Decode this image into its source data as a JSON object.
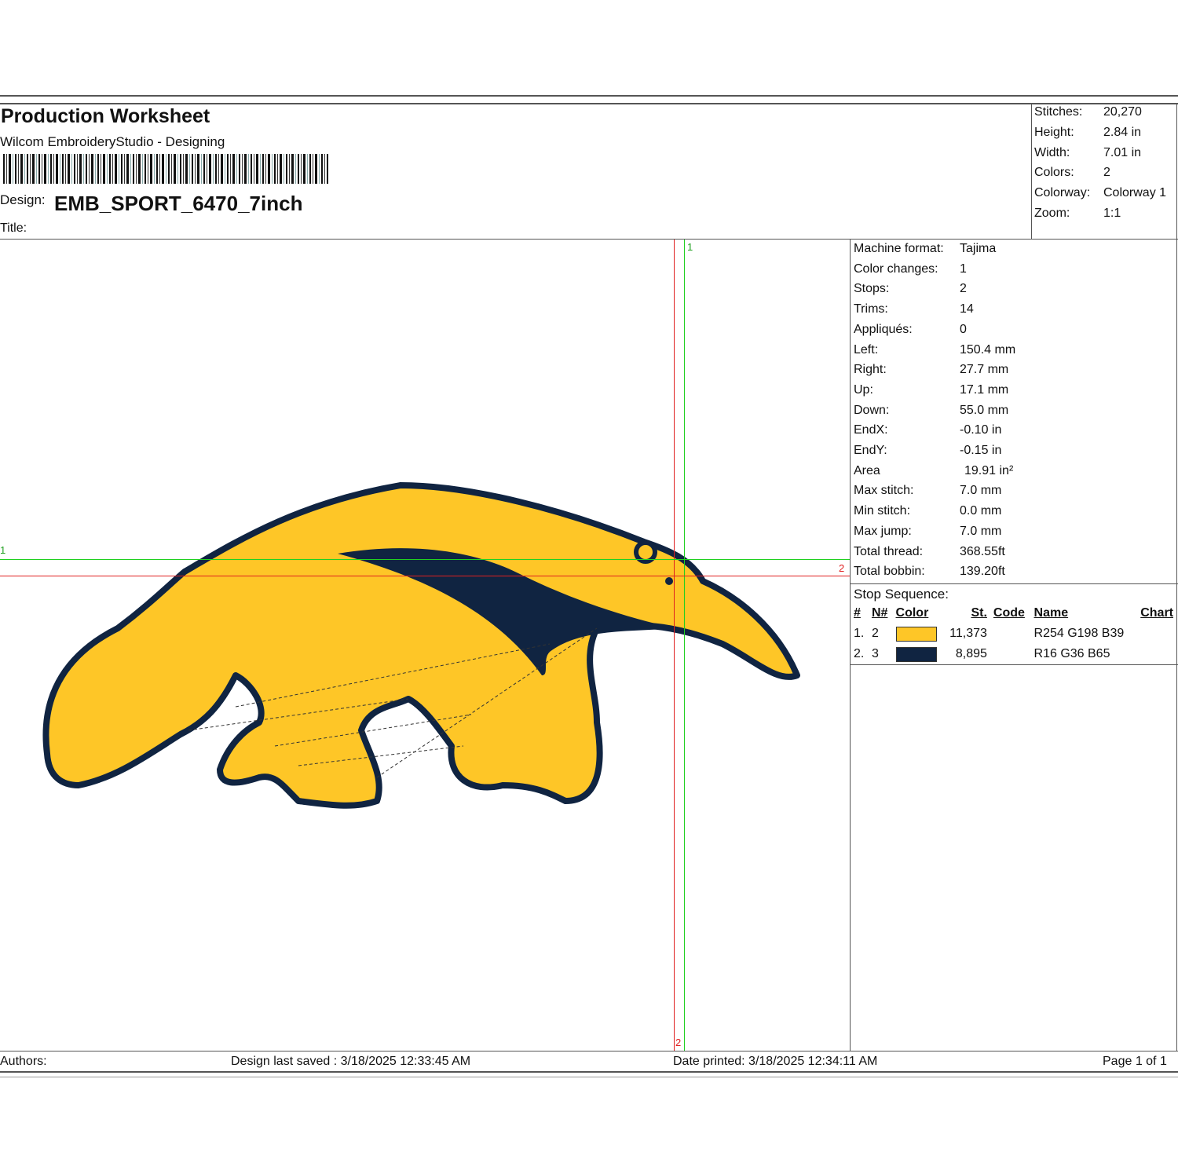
{
  "header": {
    "title": "Production Worksheet",
    "software": "Wilcom EmbroideryStudio - Designing",
    "design_label": "Design:",
    "design_name": "EMB_SPORT_6470_7inch",
    "title_label": "Title:"
  },
  "summary": [
    [
      "Stitches:",
      "20,270"
    ],
    [
      "Height:",
      "2.84 in"
    ],
    [
      "Width:",
      "7.01 in"
    ],
    [
      "Colors:",
      "2"
    ],
    [
      "Colorway:",
      "Colorway 1"
    ],
    [
      "Zoom:",
      "1:1"
    ]
  ],
  "details": [
    [
      "Machine format:",
      "Tajima"
    ],
    [
      "Color changes:",
      "1"
    ],
    [
      "Stops:",
      "2"
    ],
    [
      "Trims:",
      "14"
    ],
    [
      "Appliqués:",
      "0"
    ],
    [
      "Left:",
      "150.4 mm"
    ],
    [
      "Right:",
      "27.7 mm"
    ],
    [
      "Up:",
      "17.1 mm"
    ],
    [
      "Down:",
      "55.0 mm"
    ],
    [
      "EndX:",
      "-0.10 in"
    ],
    [
      "EndY:",
      "-0.15 in"
    ],
    [
      "Area",
      "19.91 in²"
    ],
    [
      "Max stitch:",
      "7.0 mm"
    ],
    [
      "Min stitch:",
      "0.0 mm"
    ],
    [
      "Max jump:",
      "7.0 mm"
    ],
    [
      "Total thread:",
      "368.55ft"
    ],
    [
      "Total bobbin:",
      "139.20ft"
    ]
  ],
  "stop_sequence": {
    "label": "Stop Sequence:",
    "headers": [
      "#",
      "N#",
      "Color",
      "St.",
      "Code",
      "Name",
      "Chart"
    ],
    "rows": [
      {
        "num": "1.",
        "n": "2",
        "color": "#fec627",
        "stitches": "11,373",
        "name": "R254 G198 B39"
      },
      {
        "num": "2.",
        "n": "3",
        "color": "#102441",
        "stitches": "8,895",
        "name": "R16 G36 B65"
      }
    ]
  },
  "markers": {
    "green_h": "1",
    "red_h": "2",
    "green_v": "1",
    "red_v": "2"
  },
  "footer": {
    "authors": "Authors:",
    "saved": "Design last saved : 3/18/2025 12:33:45 AM",
    "printed": "Date printed: 3/18/2025 12:34:11 AM",
    "page": "Page 1 of 1"
  }
}
